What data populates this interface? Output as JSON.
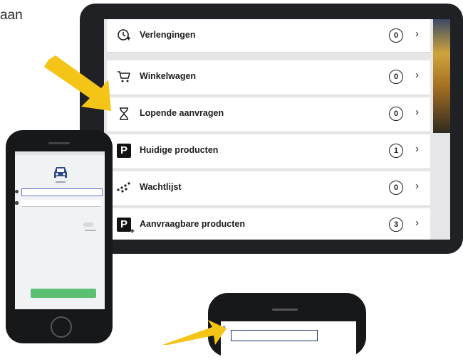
{
  "top_text": "aan",
  "tablet_list": {
    "items": [
      {
        "icon": "renewal-clock-icon",
        "label": "Verlengingen",
        "count": "0"
      },
      {
        "icon": "shopping-cart-icon",
        "label": "Winkelwagen",
        "count": "0"
      },
      {
        "icon": "hourglass-icon",
        "label": "Lopende aanvragen",
        "count": "0"
      },
      {
        "icon": "parking-p-icon",
        "label": "Huidige producten",
        "count": "1"
      },
      {
        "icon": "waitlist-people-icon",
        "label": "Wachtlijst",
        "count": "0"
      },
      {
        "icon": "parking-p-plus-icon",
        "label": "Aanvraagbare producten",
        "count": "3"
      }
    ]
  },
  "colors": {
    "arrow": "#f4c416",
    "login_button": "#5cbf73",
    "car_icon": "#2b4a86"
  }
}
